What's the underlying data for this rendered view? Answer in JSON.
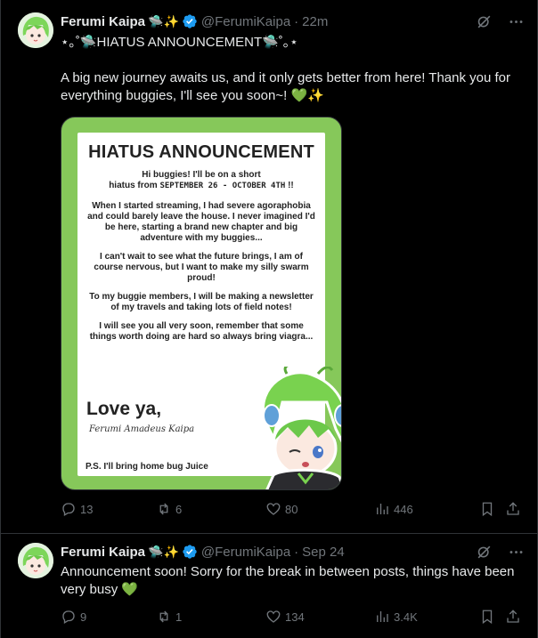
{
  "tweets": [
    {
      "author_name": "Ferumi Kaipa",
      "author_emoji": "🛸✨",
      "handle": "@FerumiKaipa",
      "separator": "·",
      "time": "22m",
      "title_line": "⋆｡˚🛸HIATUS ANNOUNCEMENT🛸˚｡⋆",
      "text": "A big new journey awaits us, and it only gets better from here! Thank you for everything buggies, I'll see you soon~! 💚✨",
      "media": {
        "title": "HIATUS ANNOUNCEMENT",
        "greeting_line1": "Hi buggies! I'll be on a short",
        "greeting_line2": "hiatus from",
        "dates": "SEPTEMBER 26 - OCTOBER 4TH",
        "greeting_end": " !!",
        "para1": "When I started streaming, I had severe agoraphobia and could barely leave the house. I never imagined I'd be here, starting a brand new chapter and big adventure with my buggies...",
        "para2": "I can't wait to see what the future brings, I am of course nervous, but I want to make my silly swarm proud!",
        "para3": "To my buggie members, I will be making a newsletter of my travels and taking lots of field notes!",
        "para4": "I will see you all very soon, remember that some things worth doing are hard so always bring viagra...",
        "closing": "Love ya,",
        "signature": "Ferumi Amadeus Kaipa",
        "ps": "P.S. I'll bring home bug Juice",
        "bg_color": "#86c85a"
      },
      "stats": {
        "replies": "13",
        "reposts": "6",
        "likes": "80",
        "views": "446"
      }
    },
    {
      "author_name": "Ferumi Kaipa",
      "author_emoji": "🛸✨",
      "handle": "@FerumiKaipa",
      "separator": "·",
      "time": "Sep 24",
      "text": "Announcement soon! Sorry for the break in between posts, things have been very busy 💚",
      "stats": {
        "replies": "9",
        "reposts": "1",
        "likes": "134",
        "views": "3.4K"
      }
    }
  ],
  "colors": {
    "background": "#000000",
    "text": "#e7e9ea",
    "muted": "#71767b",
    "border": "#2f3336",
    "verified": "#1d9bf0",
    "avatar_green": "#7dd65a"
  },
  "icons": [
    "grok-icon",
    "more-icon",
    "reply-icon",
    "repost-icon",
    "like-icon",
    "views-icon",
    "bookmark-icon",
    "share-icon",
    "verified-icon"
  ]
}
